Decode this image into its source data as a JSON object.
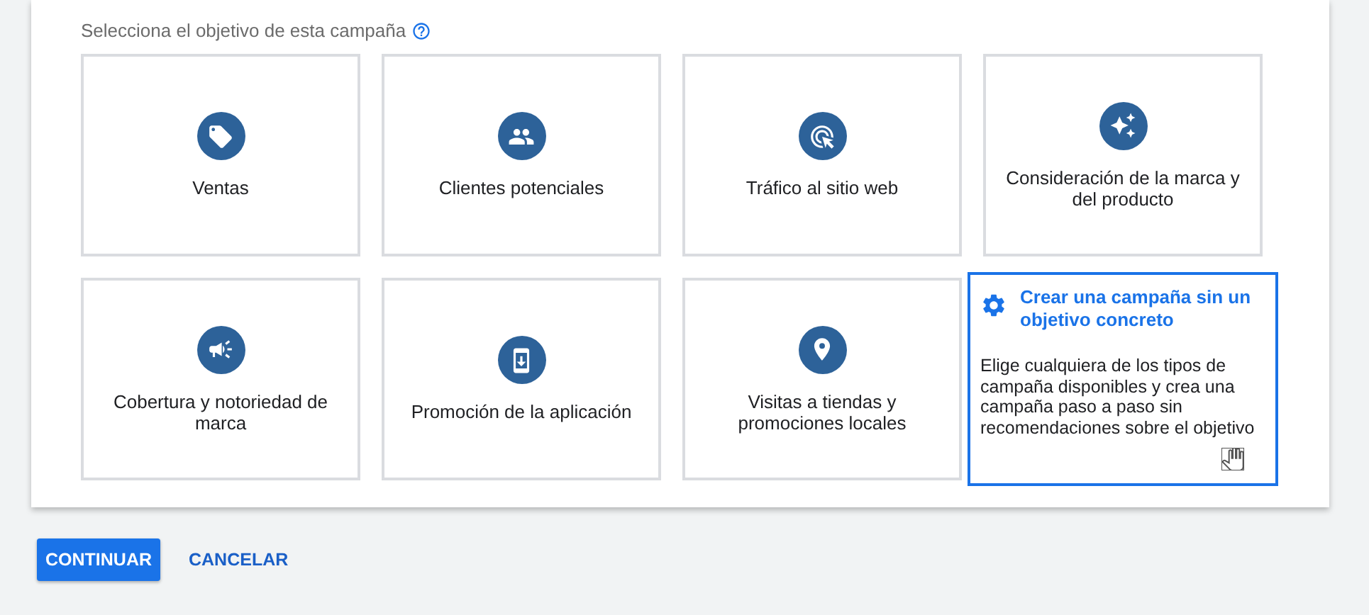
{
  "prompt": "Selecciona el objetivo de esta campaña",
  "objectives": [
    {
      "kind": "objective",
      "label": "Ventas"
    },
    {
      "kind": "objective",
      "label": "Clientes potenciales"
    },
    {
      "kind": "objective",
      "label": "Tráfico al sitio web"
    },
    {
      "kind": "objective",
      "label": "Consideración de la marca y del producto"
    },
    {
      "kind": "objective",
      "label": "Cobertura y notoriedad de marca"
    },
    {
      "kind": "objective",
      "label": "Promoción de la aplicación"
    },
    {
      "kind": "objective",
      "label": "Visitas a tiendas y promociones locales"
    },
    {
      "kind": "custom",
      "label": "Crear una campaña sin un objetivo concreto",
      "description": "Elige cualquiera de los tipos de campaña disponibles y crea una campaña paso a paso sin recomendaciones sobre el objetivo"
    }
  ],
  "buttons": [
    {
      "kind": "primary",
      "label": "CONTINUAR"
    },
    {
      "kind": "text",
      "label": "CANCELAR"
    }
  ]
}
